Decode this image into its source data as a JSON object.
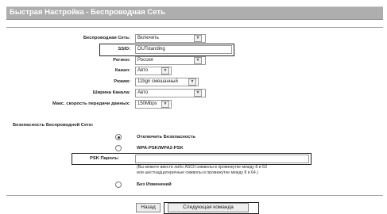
{
  "title": "Быстрая Настройка - Беспроводная Сеть",
  "fields": {
    "wireless_label": "Беспроводная Сеть:",
    "wireless_value": "Включить",
    "ssid_label": "SSID:",
    "ssid_value": "OUTstanding",
    "region_label": "Регион:",
    "region_value": "Россия",
    "channel_label": "Канал:",
    "channel_value": "Авто",
    "mode_label": "Режим:",
    "mode_value": "11bgn смешанный",
    "width_label": "Ширина Канала:",
    "width_value": "Авто",
    "rate_label": "Макс. скорость передачи данных:",
    "rate_value": "150Mbps"
  },
  "security": {
    "heading": "Безопасность Беспроводной Сети:",
    "options": [
      "Отключить Безопасность",
      "WPA-PSK/WPA2-PSK",
      "Без Изменений"
    ],
    "selected": 0,
    "psk_label": "PSK Пароль:",
    "psk_value": "",
    "hint_line1": "(Вы можете ввести либо ASCII символы в промежутке между 8 и 63",
    "hint_line2": "или шестнадцатеричные символы в промежутке между 8 и 64.)"
  },
  "buttons": {
    "back": "Назад",
    "next": "Следующая команда"
  },
  "icons": {
    "dropdown": "chevron-down-icon",
    "radio": "radio-icon"
  }
}
